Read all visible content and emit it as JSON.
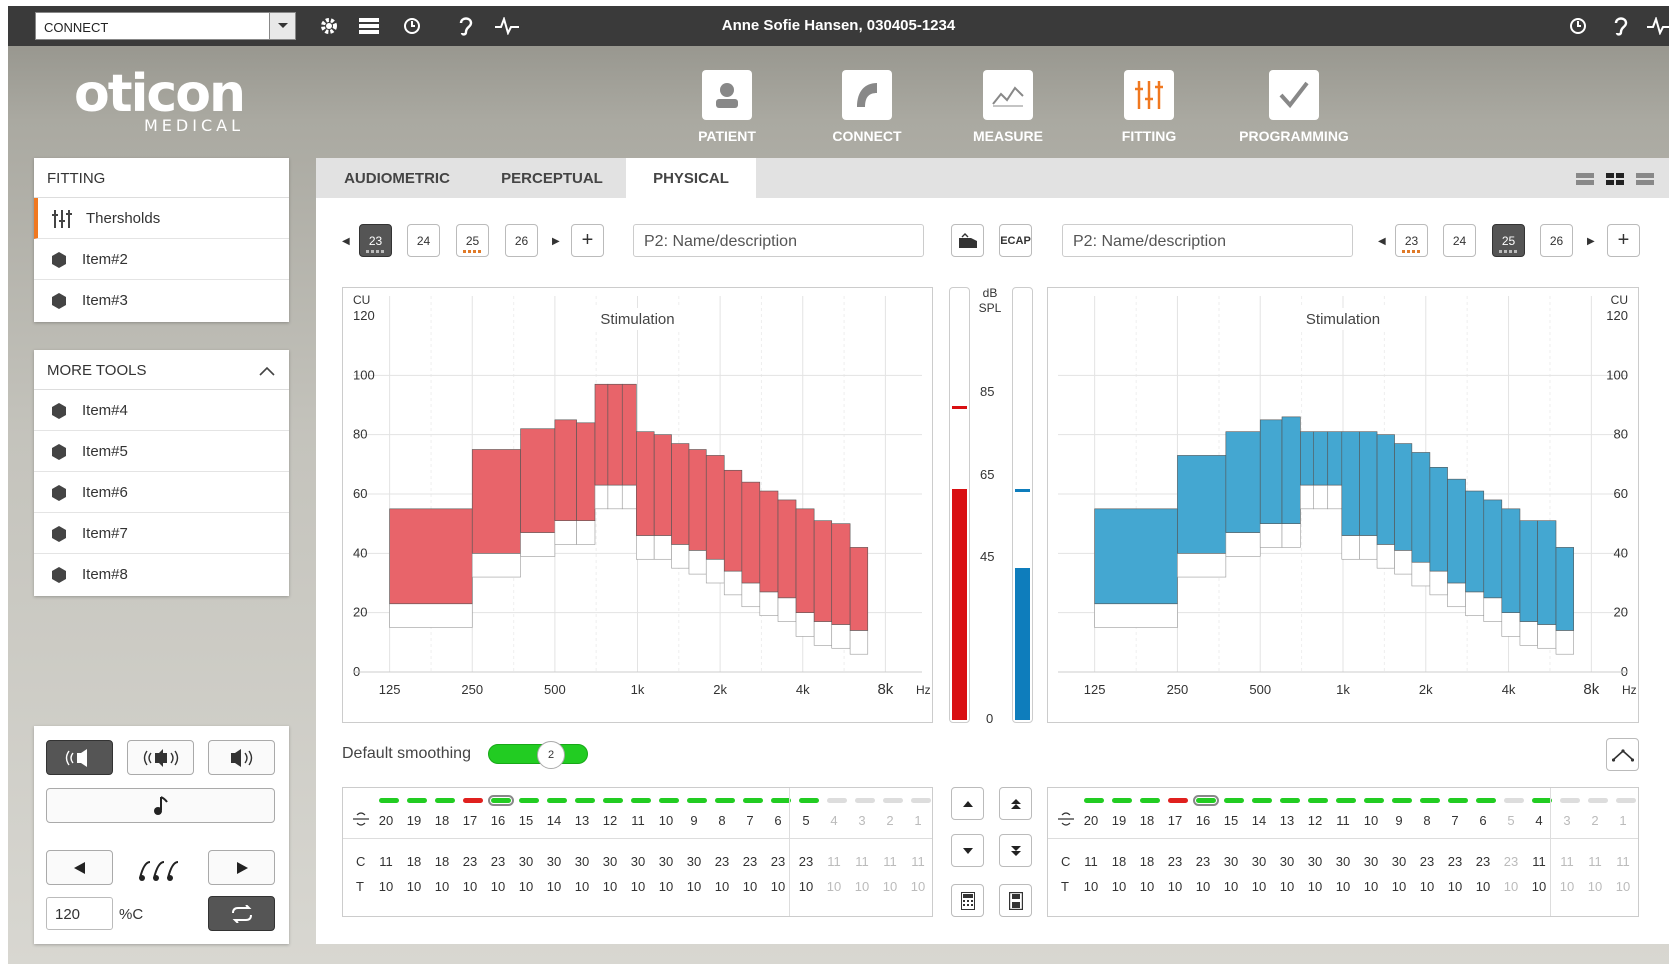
{
  "topbar": {
    "connect_select": "CONNECT",
    "patient": "Anne Sofie Hansen, 030405-1234",
    "left_icons": [
      "gear-icon",
      "list-icon",
      "history-icon",
      "ear-icon",
      "pulse-icon"
    ],
    "right_icons": [
      "history-icon",
      "ear-icon",
      "pulse-icon"
    ]
  },
  "logo": {
    "brand": "oticon",
    "sub": "MEDICAL"
  },
  "nav": [
    {
      "label": "PATIENT",
      "icon": "patient-icon"
    },
    {
      "label": "CONNECT",
      "icon": "connect-icon"
    },
    {
      "label": "MEASURE",
      "icon": "measure-icon"
    },
    {
      "label": "FITTING",
      "icon": "fitting-icon",
      "active": true
    },
    {
      "label": "PROGRAMMING",
      "icon": "check-icon"
    }
  ],
  "fitting_panel": {
    "title": "FITTING",
    "items": [
      "Thersholds",
      "Item#2",
      "Item#3"
    ]
  },
  "tools_panel": {
    "title": "MORE TOOLS",
    "items": [
      "Item#4",
      "Item#5",
      "Item#6",
      "Item#7",
      "Item#8"
    ]
  },
  "bottom_panel": {
    "percent_value": "120",
    "percent_unit": "%C"
  },
  "tabs": [
    "AUDIOMETRIC",
    "PERCEPTUAL",
    "PHYSICAL"
  ],
  "left_header": {
    "chips": [
      "23",
      "24",
      "25",
      "26"
    ],
    "selected": "23",
    "name_placeholder": "P2: Name/description",
    "ecap": "ECAP"
  },
  "right_header": {
    "chips": [
      "23",
      "24",
      "25",
      "26"
    ],
    "selected": "25",
    "name_placeholder": "P2: Name/description"
  },
  "chart_common": {
    "title": "Stimulation",
    "ylabel": "CU",
    "y_ticks": [
      "120",
      "100",
      "80",
      "60",
      "40",
      "20",
      "0"
    ],
    "x_ticks": [
      "125",
      "250",
      "500",
      "1k",
      "2k",
      "4k",
      "8k"
    ],
    "x_unit": "Hz"
  },
  "level_meter": {
    "unit_top": "dB",
    "unit_bottom": "SPL",
    "ticks": [
      "85",
      "65",
      "45",
      "0"
    ]
  },
  "smoothing": {
    "label": "Default smoothing",
    "value": "2"
  },
  "left_table": {
    "electrodes": [
      "20",
      "19",
      "18",
      "17",
      "16",
      "15",
      "14",
      "13",
      "12",
      "11",
      "10",
      "9",
      "8",
      "7",
      "6",
      "5",
      "4",
      "3",
      "2",
      "1"
    ],
    "c_label": "C",
    "t_label": "T",
    "c_values": [
      "11",
      "18",
      "18",
      "23",
      "23",
      "30",
      "30",
      "30",
      "30",
      "30",
      "30",
      "30",
      "23",
      "23",
      "23",
      "23",
      "11",
      "11",
      "11",
      "11"
    ],
    "t_values": [
      "10",
      "10",
      "10",
      "10",
      "10",
      "10",
      "10",
      "10",
      "10",
      "10",
      "10",
      "10",
      "10",
      "10",
      "10",
      "10",
      "10",
      "10",
      "10",
      "10"
    ]
  },
  "right_table": {
    "electrodes": [
      "20",
      "19",
      "18",
      "17",
      "16",
      "15",
      "14",
      "13",
      "12",
      "11",
      "10",
      "9",
      "8",
      "7",
      "6",
      "5",
      "4",
      "3",
      "2",
      "1"
    ],
    "c_label": "C",
    "t_label": "T",
    "c_values": [
      "11",
      "18",
      "18",
      "23",
      "23",
      "30",
      "30",
      "30",
      "30",
      "30",
      "30",
      "30",
      "23",
      "23",
      "23",
      "23",
      "11",
      "11",
      "11",
      "11"
    ],
    "t_values": [
      "10",
      "10",
      "10",
      "10",
      "10",
      "10",
      "10",
      "10",
      "10",
      "10",
      "10",
      "10",
      "10",
      "10",
      "10",
      "10",
      "10",
      "10",
      "10",
      "10"
    ]
  },
  "colors": {
    "left_series": "#e8646a",
    "right_series": "#44a7d1",
    "meter_red": "#d90f12",
    "meter_blue": "#0e7dbc",
    "active_green": "#22cc22"
  },
  "chart_data": [
    {
      "type": "bar",
      "title": "Stimulation",
      "ylabel": "CU",
      "xlabel": "Hz",
      "ylim": [
        0,
        120
      ],
      "x_scale": "log",
      "series": [
        {
          "name": "Left",
          "bars": [
            [
              125,
              250,
              23,
              55
            ],
            [
              250,
              375,
              40,
              75
            ],
            [
              375,
              500,
              47,
              82
            ],
            [
              500,
              600,
              51,
              85
            ],
            [
              600,
              700,
              51,
              84
            ],
            [
              700,
              780,
              63,
              97
            ],
            [
              780,
              880,
              63,
              97
            ],
            [
              880,
              990,
              63,
              97
            ],
            [
              990,
              1150,
              46,
              81
            ],
            [
              1150,
              1330,
              46,
              80
            ],
            [
              1330,
              1540,
              43,
              77
            ],
            [
              1540,
              1780,
              41,
              75
            ],
            [
              1780,
              2070,
              38,
              73
            ],
            [
              2070,
              2400,
              34,
              68
            ],
            [
              2400,
              2790,
              30,
              64
            ],
            [
              2790,
              3250,
              27,
              61
            ],
            [
              3250,
              3780,
              25,
              58
            ],
            [
              3780,
              4400,
              20,
              55
            ],
            [
              4400,
              5100,
              17,
              51
            ],
            [
              5100,
              5950,
              16,
              50
            ],
            [
              5950,
              6900,
              14,
              42
            ]
          ]
        },
        {
          "name": "Right",
          "bars": [
            [
              125,
              250,
              23,
              55
            ],
            [
              250,
              375,
              40,
              73
            ],
            [
              375,
              500,
              47,
              81
            ],
            [
              500,
              600,
              50,
              85
            ],
            [
              600,
              700,
              50,
              86
            ],
            [
              700,
              780,
              63,
              81
            ],
            [
              780,
              880,
              63,
              81
            ],
            [
              880,
              990,
              63,
              81
            ],
            [
              990,
              1150,
              46,
              81
            ],
            [
              1150,
              1330,
              46,
              81
            ],
            [
              1330,
              1540,
              43,
              80
            ],
            [
              1540,
              1780,
              41,
              77
            ],
            [
              1780,
              2070,
              37,
              74
            ],
            [
              2070,
              2400,
              34,
              69
            ],
            [
              2400,
              2790,
              30,
              65
            ],
            [
              2790,
              3250,
              27,
              61
            ],
            [
              3250,
              3780,
              25,
              58
            ],
            [
              3780,
              4400,
              20,
              55
            ],
            [
              4400,
              5100,
              17,
              51
            ],
            [
              5100,
              5950,
              16,
              51
            ],
            [
              5950,
              6900,
              14,
              42
            ]
          ]
        }
      ]
    },
    {
      "type": "bar",
      "title": "dB SPL",
      "ylim": [
        0,
        100
      ],
      "series": [
        {
          "name": "Left level",
          "values": [
            64
          ]
        },
        {
          "name": "Right level",
          "values": [
            42
          ]
        }
      ]
    }
  ]
}
